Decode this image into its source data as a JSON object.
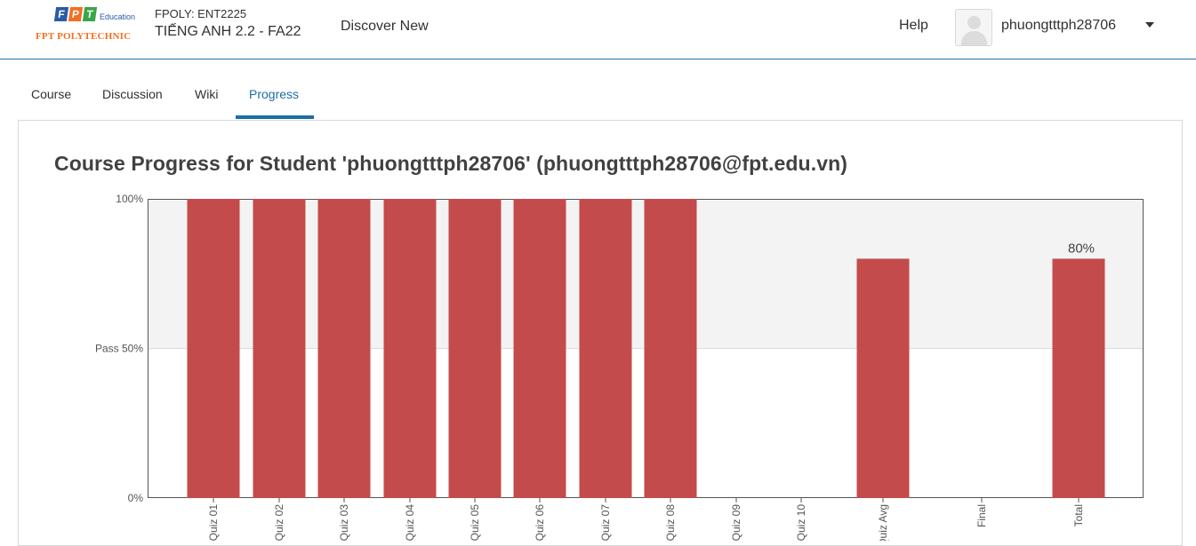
{
  "header": {
    "logo_brand": "FPT",
    "logo_sub": "Education",
    "logo_name": "FPT POLYTECHNIC",
    "course_org": "FPOLY: ENT2225",
    "course_name": "TIẾNG ANH 2.2 - FA22",
    "discover": "Discover New",
    "help": "Help",
    "username": "phuongtttph28706"
  },
  "tabs": [
    {
      "label": "Course",
      "active": false
    },
    {
      "label": "Discussion",
      "active": false
    },
    {
      "label": "Wiki",
      "active": false
    },
    {
      "label": "Progress",
      "active": true
    }
  ],
  "page": {
    "title": "Course Progress for Student 'phuongtttph28706' (phuongtttph28706@fpt.edu.vn)"
  },
  "chart_data": {
    "type": "bar",
    "categories": [
      "Quiz 01",
      "Quiz 02",
      "Quiz 03",
      "Quiz 04",
      "Quiz 05",
      "Quiz 06",
      "Quiz 07",
      "Quiz 08",
      "Quiz 09",
      "Quiz 10",
      "Quiz Avg",
      "Final",
      "Total"
    ],
    "values": [
      100,
      100,
      100,
      100,
      100,
      100,
      100,
      100,
      0,
      0,
      80,
      0,
      80
    ],
    "ytick_labels": [
      "0%",
      "Pass 50%",
      "100%"
    ],
    "ytick_values": [
      0,
      50,
      100
    ],
    "ylim": [
      0,
      100
    ],
    "data_labels": {
      "Total": "80%"
    },
    "colors": {
      "bar": "#c44b4b",
      "pass_region": "#f3f3f3"
    }
  }
}
